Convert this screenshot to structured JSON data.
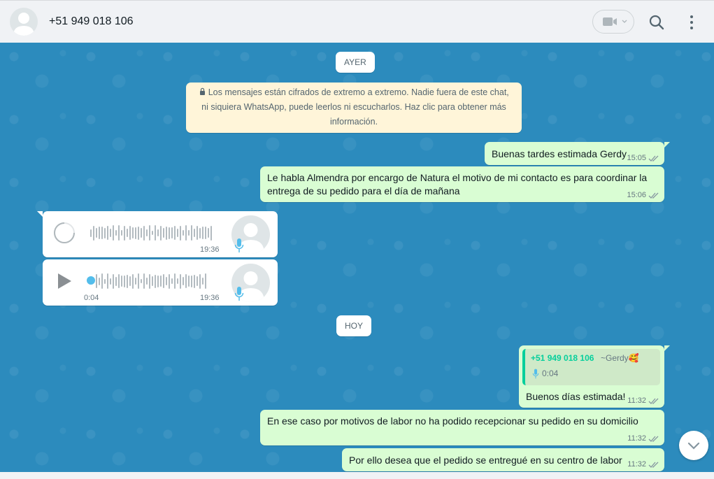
{
  "header": {
    "contact_name": "+51 949 018 106",
    "icons": {
      "avatar": "default-avatar-icon",
      "video": "video-camera-icon",
      "search": "search-icon",
      "menu": "more-vertical-icon"
    }
  },
  "chat": {
    "date_yesterday": "AYER",
    "encryption_notice": "Los mensajes están cifrados de extremo a extremo. Nadie fuera de este chat, ni siquiera WhatsApp, puede leerlos ni escucharlos. Haz clic para obtener más información.",
    "messages": [
      {
        "text": "Buenas tardes estimada Gerdy",
        "time": "15:05"
      },
      {
        "text": "Le habla Almendra por encargo de Natura el motivo de mi contacto es para coordinar la entrega de su pedido para el día de mañana",
        "time": "15:06"
      }
    ],
    "voice_notes": [
      {
        "time": "19:36",
        "state": "loading"
      },
      {
        "time": "19:36",
        "duration": "0:04",
        "state": "ready"
      }
    ],
    "date_today": "HOY",
    "reply_message": {
      "quoted_phone": "+51 949 018 106",
      "quoted_name": "~Gerdy",
      "quoted_emoji": "🥰",
      "quoted_voice_duration": "0:04",
      "text": "Buenos días estimada!",
      "time": "11:32"
    },
    "messages_today": [
      {
        "text": "En ese caso por motivos de labor no ha podido recepcionar su pedido en su domicilio",
        "time": "11:32"
      },
      {
        "text": "Por ello desea que el pedido se entregué en su centro de labor",
        "time": "11:32"
      }
    ]
  },
  "colors": {
    "chat_background": "#2c8bbd",
    "outgoing_bubble": "#d9fdd3",
    "incoming_bubble": "#ffffff",
    "notice_background": "#fff5d9",
    "accent": "#06cf9c",
    "voice_dot": "#53bdeb"
  }
}
